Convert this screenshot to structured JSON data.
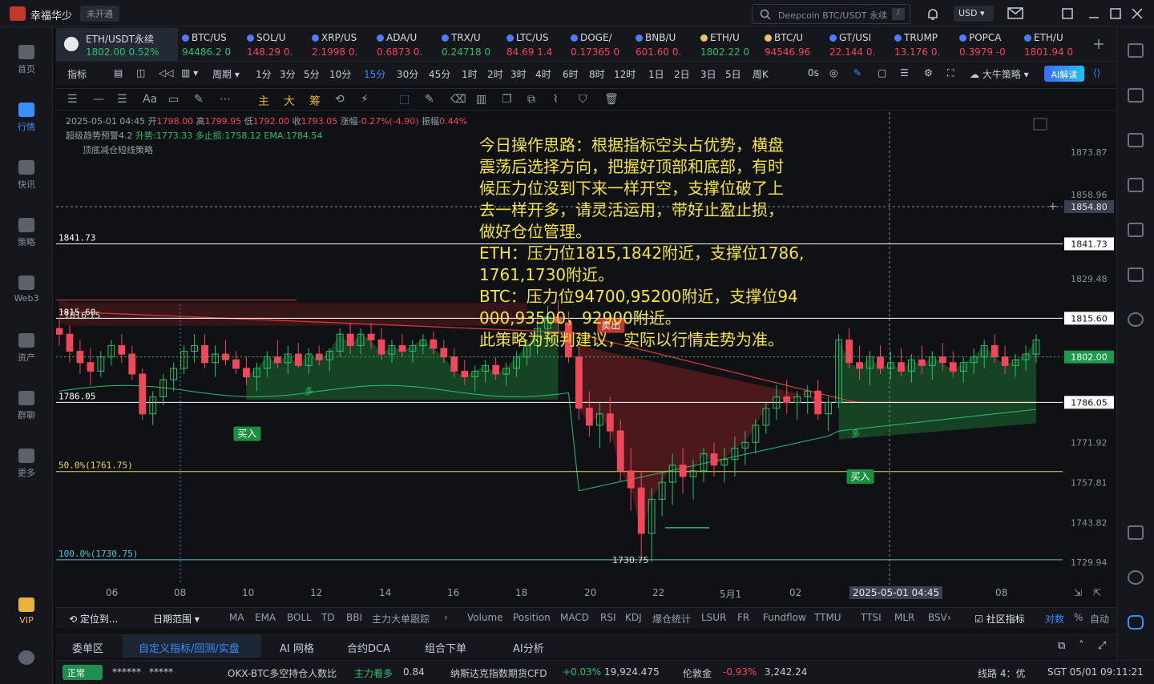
{
  "titlebar": {
    "app_name": "幸福华少",
    "status": "未开通",
    "search_placeholder": "Deepcoin BTC/USDT 永续",
    "search_shortcut": "/",
    "currency": "USD"
  },
  "sidebar": {
    "items": [
      {
        "label": "首页",
        "icon": "home-icon"
      },
      {
        "label": "行情",
        "icon": "market-chart-icon",
        "active": true
      },
      {
        "label": "快讯",
        "icon": "news-icon"
      },
      {
        "label": "策略",
        "icon": "strategy-robot-icon"
      },
      {
        "label": "Web3",
        "icon": "web3-icon"
      },
      {
        "label": "资产",
        "icon": "wallet-icon"
      },
      {
        "label": "群聊",
        "icon": "chat-icon"
      },
      {
        "label": "更多",
        "icon": "more-grid-icon"
      }
    ],
    "vip_label": "VIP"
  },
  "tickers": [
    {
      "symbol": "ETH/USDT永续",
      "price": "1802.00",
      "change": "0.52%",
      "dir": "up",
      "active": true
    },
    {
      "symbol": "BTC/US",
      "price": "94486.2",
      "change": "0",
      "dir": "up"
    },
    {
      "symbol": "SOL/U",
      "price": "148.29",
      "change": "0.",
      "dir": "dn"
    },
    {
      "symbol": "XRP/US",
      "price": "2.1998",
      "change": "0.",
      "dir": "dn"
    },
    {
      "symbol": "ADA/U",
      "price": "0.6873",
      "change": "0.",
      "dir": "dn"
    },
    {
      "symbol": "TRX/U",
      "price": "0.24718",
      "change": "0",
      "dir": "up"
    },
    {
      "symbol": "LTC/US",
      "price": "84.69",
      "change": "1.4",
      "dir": "dn"
    },
    {
      "symbol": "DOGE/",
      "price": "0.17365",
      "change": "0",
      "dir": "dn"
    },
    {
      "symbol": "BNB/U",
      "price": "601.60",
      "change": "0.",
      "dir": "dn"
    },
    {
      "symbol": "ETH/U",
      "price": "1802.22",
      "change": "0",
      "dir": "up"
    },
    {
      "symbol": "BTC/U",
      "price": "94546.96",
      "change": "",
      "dir": "dn"
    },
    {
      "symbol": "GT/USI",
      "price": "22.144",
      "change": "0.",
      "dir": "dn"
    },
    {
      "symbol": "TRUMP",
      "price": "13.176",
      "change": "0.",
      "dir": "dn"
    },
    {
      "symbol": "POPCA",
      "price": "0.3979",
      "change": "-0",
      "dir": "dn"
    },
    {
      "symbol": "ETH/U",
      "price": "1801.94",
      "change": "0",
      "dir": "dn"
    }
  ],
  "toolbar1": {
    "indicators": "指标",
    "period": "周期",
    "intervals": [
      "1分",
      "3分",
      "5分",
      "10分",
      "15分",
      "30分",
      "45分",
      "1时",
      "2时",
      "3时",
      "4时",
      "6时",
      "8时",
      "12时",
      "1日",
      "2日",
      "3日",
      "5日",
      "周K"
    ],
    "selected_interval": "15分",
    "countdown": "0s",
    "strategy": "大牛策略",
    "ai": "AI解读"
  },
  "toolbar2": {
    "tools": [
      "主",
      "大",
      "筹"
    ]
  },
  "chart_info": {
    "line1": {
      "date": "2025-05-01 04:45",
      "open_label": "开",
      "open": "1798.00",
      "high_label": "高",
      "high": "1799.95",
      "low_label": "低",
      "low": "1792.00",
      "close_label": "收",
      "close": "1793.05",
      "change_label": "涨幅",
      "change": "-0.27%(-4.90)",
      "amp_label": "振幅",
      "amp": "0.44%"
    },
    "line2": {
      "name": "超级趋势预警4.2",
      "up": "升势:1773.33",
      "long": "多止损:1758.12",
      "ema": "EMA:1784.54"
    },
    "line3": {
      "name": "顶底减仓短线策略"
    }
  },
  "annotation": {
    "lines": [
      "今日操作思路：根据指标空头占优势，横盘",
      "震荡后选择方向，把握好顶部和底部，有时",
      "候压力位没到下来一样开空，支撑位破了上",
      "去一样开多，请灵活运用，带好止盈止损，",
      "做好仓位管理。",
      "ETH：压力位1815,1842附近，支撑位1786,",
      "1761,1730附近。",
      "BTC：压力位94700,95200附近，支撑位94",
      "000,93500，92900附近。",
      "此策略为预判建议，实际以行情走势为准。"
    ]
  },
  "chart_data": {
    "type": "candlestick",
    "y_axis_ticks": [
      "1873.87",
      "1858.96",
      "1829.48",
      "1771.92",
      "1757.81",
      "1743.82",
      "1729.94"
    ],
    "ylim": [
      1722,
      1888
    ],
    "x_axis_ticks": [
      "06",
      "08",
      "10",
      "12",
      "14",
      "16",
      "18",
      "20",
      "22",
      "5月1",
      "02",
      "04",
      "06",
      "08"
    ],
    "crosshair_time": "2025-05-01 04:45",
    "crosshair_price": "1854.80",
    "current_price": "1802.00",
    "levels": [
      {
        "label": "1841.73",
        "value": 1841.73,
        "color": "#ffffff"
      },
      {
        "label": "1815.60",
        "value": 1815.6,
        "color": "#ffffff"
      },
      {
        "label": "1786.05",
        "value": 1786.05,
        "color": "#ffffff"
      },
      {
        "label": "50.0%(1761.75)",
        "value": 1761.75,
        "color": "#e8d36b"
      },
      {
        "label": "100.0%(1730.75)",
        "value": 1730.75,
        "color": "#5ec2d9"
      }
    ],
    "extra_labels": {
      "l1816": "1816.15",
      "low": "1730.75"
    },
    "signals": [
      {
        "label": "买入",
        "type": "buy"
      },
      {
        "label": "卖出",
        "type": "sell"
      },
      {
        "label": "买入",
        "type": "buy"
      }
    ],
    "trend_tag": "多",
    "candles": [
      [
        1812,
        1816,
        1806,
        1810
      ],
      [
        1810,
        1813,
        1800,
        1804
      ],
      [
        1804,
        1808,
        1796,
        1800
      ],
      [
        1800,
        1805,
        1792,
        1797
      ],
      [
        1797,
        1804,
        1795,
        1802
      ],
      [
        1802,
        1808,
        1799,
        1806
      ],
      [
        1806,
        1810,
        1800,
        1803
      ],
      [
        1803,
        1806,
        1794,
        1796
      ],
      [
        1796,
        1798,
        1780,
        1782
      ],
      [
        1782,
        1790,
        1778,
        1788
      ],
      [
        1788,
        1796,
        1785,
        1794
      ],
      [
        1794,
        1800,
        1790,
        1798
      ],
      [
        1798,
        1806,
        1796,
        1804
      ],
      [
        1804,
        1810,
        1800,
        1806
      ],
      [
        1806,
        1810,
        1798,
        1800
      ],
      [
        1800,
        1806,
        1795,
        1803
      ],
      [
        1803,
        1808,
        1799,
        1801
      ],
      [
        1801,
        1804,
        1796,
        1798
      ],
      [
        1798,
        1802,
        1792,
        1795
      ],
      [
        1795,
        1800,
        1790,
        1798
      ],
      [
        1798,
        1804,
        1795,
        1802
      ],
      [
        1802,
        1808,
        1798,
        1800
      ],
      [
        1800,
        1806,
        1796,
        1803
      ],
      [
        1803,
        1807,
        1798,
        1799
      ],
      [
        1799,
        1805,
        1796,
        1803
      ],
      [
        1803,
        1806,
        1799,
        1801
      ],
      [
        1801,
        1805,
        1797,
        1804
      ],
      [
        1804,
        1812,
        1802,
        1810
      ],
      [
        1810,
        1814,
        1803,
        1806
      ],
      [
        1806,
        1812,
        1803,
        1810
      ],
      [
        1810,
        1814,
        1805,
        1808
      ],
      [
        1808,
        1812,
        1801,
        1803
      ],
      [
        1803,
        1808,
        1800,
        1806
      ],
      [
        1806,
        1810,
        1802,
        1804
      ],
      [
        1804,
        1808,
        1800,
        1806
      ],
      [
        1806,
        1810,
        1803,
        1808
      ],
      [
        1808,
        1811,
        1803,
        1805
      ],
      [
        1805,
        1808,
        1800,
        1802
      ],
      [
        1802,
        1805,
        1795,
        1797
      ],
      [
        1797,
        1801,
        1792,
        1795
      ],
      [
        1795,
        1799,
        1790,
        1797
      ],
      [
        1797,
        1801,
        1793,
        1799
      ],
      [
        1799,
        1802,
        1794,
        1796
      ],
      [
        1796,
        1800,
        1792,
        1798
      ],
      [
        1798,
        1804,
        1795,
        1802
      ],
      [
        1802,
        1808,
        1799,
        1806
      ],
      [
        1806,
        1815,
        1803,
        1812
      ],
      [
        1812,
        1820,
        1808,
        1816
      ],
      [
        1816,
        1822,
        1810,
        1814
      ],
      [
        1814,
        1818,
        1800,
        1802
      ],
      [
        1802,
        1806,
        1780,
        1784
      ],
      [
        1784,
        1790,
        1774,
        1778
      ],
      [
        1778,
        1786,
        1770,
        1782
      ],
      [
        1782,
        1788,
        1772,
        1776
      ],
      [
        1776,
        1780,
        1758,
        1762
      ],
      [
        1762,
        1770,
        1748,
        1756
      ],
      [
        1756,
        1762,
        1732,
        1740
      ],
      [
        1740,
        1756,
        1730,
        1752
      ],
      [
        1752,
        1762,
        1746,
        1758
      ],
      [
        1758,
        1768,
        1750,
        1764
      ],
      [
        1764,
        1770,
        1754,
        1760
      ],
      [
        1760,
        1766,
        1752,
        1762
      ],
      [
        1762,
        1770,
        1758,
        1768
      ],
      [
        1768,
        1772,
        1760,
        1764
      ],
      [
        1764,
        1770,
        1758,
        1766
      ],
      [
        1766,
        1774,
        1760,
        1770
      ],
      [
        1770,
        1776,
        1764,
        1772
      ],
      [
        1772,
        1780,
        1768,
        1778
      ],
      [
        1778,
        1786,
        1775,
        1784
      ],
      [
        1784,
        1792,
        1780,
        1788
      ],
      [
        1788,
        1794,
        1782,
        1786
      ],
      [
        1786,
        1790,
        1780,
        1788
      ],
      [
        1788,
        1792,
        1782,
        1790
      ],
      [
        1790,
        1794,
        1780,
        1782
      ],
      [
        1782,
        1788,
        1776,
        1786
      ],
      [
        1786,
        1810,
        1784,
        1808
      ],
      [
        1808,
        1812,
        1798,
        1800
      ],
      [
        1800,
        1806,
        1794,
        1798
      ],
      [
        1798,
        1804,
        1792,
        1802
      ],
      [
        1802,
        1806,
        1796,
        1798
      ],
      [
        1798,
        1804,
        1794,
        1800
      ],
      [
        1800,
        1805,
        1795,
        1797
      ],
      [
        1797,
        1803,
        1793,
        1801
      ],
      [
        1801,
        1806,
        1796,
        1799
      ],
      [
        1799,
        1804,
        1794,
        1802
      ],
      [
        1802,
        1807,
        1797,
        1800
      ],
      [
        1800,
        1804,
        1795,
        1797
      ],
      [
        1797,
        1802,
        1793,
        1800
      ],
      [
        1800,
        1805,
        1796,
        1802
      ],
      [
        1802,
        1808,
        1798,
        1806
      ],
      [
        1806,
        1810,
        1800,
        1802
      ],
      [
        1802,
        1806,
        1796,
        1799
      ],
      [
        1799,
        1803,
        1795,
        1801
      ],
      [
        1801,
        1806,
        1797,
        1803
      ],
      [
        1803,
        1810,
        1800,
        1808
      ]
    ]
  },
  "indicator_bar": {
    "locate": "定位到...",
    "date_range": "日期范围",
    "main": [
      "MA",
      "EMA",
      "BOLL",
      "TD",
      "BBI",
      "主力大单跟踪"
    ],
    "sub": [
      "Volume",
      "Position",
      "MACD",
      "RSI",
      "KDJ",
      "爆仓统计",
      "LSUR",
      "FR",
      "Fundflow",
      "TTMU",
      "TTSI",
      "MLR",
      "BSV"
    ],
    "community": "社区指标",
    "log": "对数",
    "pct": "%",
    "auto": "自动"
  },
  "bottom_tabs": [
    "委单区",
    "自定义指标/回测/实盘",
    "AI 网格",
    "合约DCA",
    "组合下单",
    "AI分析"
  ],
  "statusbar": {
    "normal": "正常",
    "mask1": "******",
    "mask2": "*****",
    "i1_name": "OKX-BTC多空持仓人数比",
    "i1_tag": "主力看多",
    "i1_val": "0.84",
    "i2_name": "纳斯达克指数期货CFD",
    "i2_chg": "+0.03%",
    "i2_val": "19,924.475",
    "i3_name": "伦敦金",
    "i3_chg": "-0.93%",
    "i3_val": "3,242.24",
    "line": "线路 4：优",
    "time": "SGT 05/01 09:11:21"
  }
}
